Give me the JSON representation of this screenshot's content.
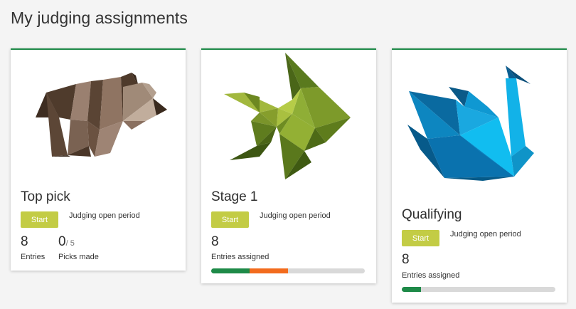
{
  "page": {
    "title": "My judging assignments"
  },
  "theme": {
    "accent_border": "#1e8a48",
    "start_button": "#c3cc45",
    "progress_green": "#1e8a48",
    "progress_orange": "#f26b1d",
    "progress_track": "#d9d9d9"
  },
  "cards": [
    {
      "illustration": "origami-bear-icon",
      "title": "Top pick",
      "start_label": "Start",
      "period_label": "Judging open period",
      "entries_count": "8",
      "entries_label": "Entries",
      "picks_made": "0",
      "picks_total": "/ 5",
      "picks_label": "Picks made"
    },
    {
      "illustration": "origami-fish-icon",
      "title": "Stage 1",
      "start_label": "Start",
      "period_label": "Judging open period",
      "entries_count": "8",
      "entries_label": "Entries assigned",
      "progress": {
        "green_fraction": 0.25,
        "orange_fraction": 0.25
      }
    },
    {
      "illustration": "origami-swan-icon",
      "title": "Qualifying",
      "start_label": "Start",
      "period_label": "Judging open period",
      "entries_count": "8",
      "entries_label": "Entries assigned",
      "progress": {
        "green_fraction": 0.125,
        "orange_fraction": 0
      }
    }
  ]
}
